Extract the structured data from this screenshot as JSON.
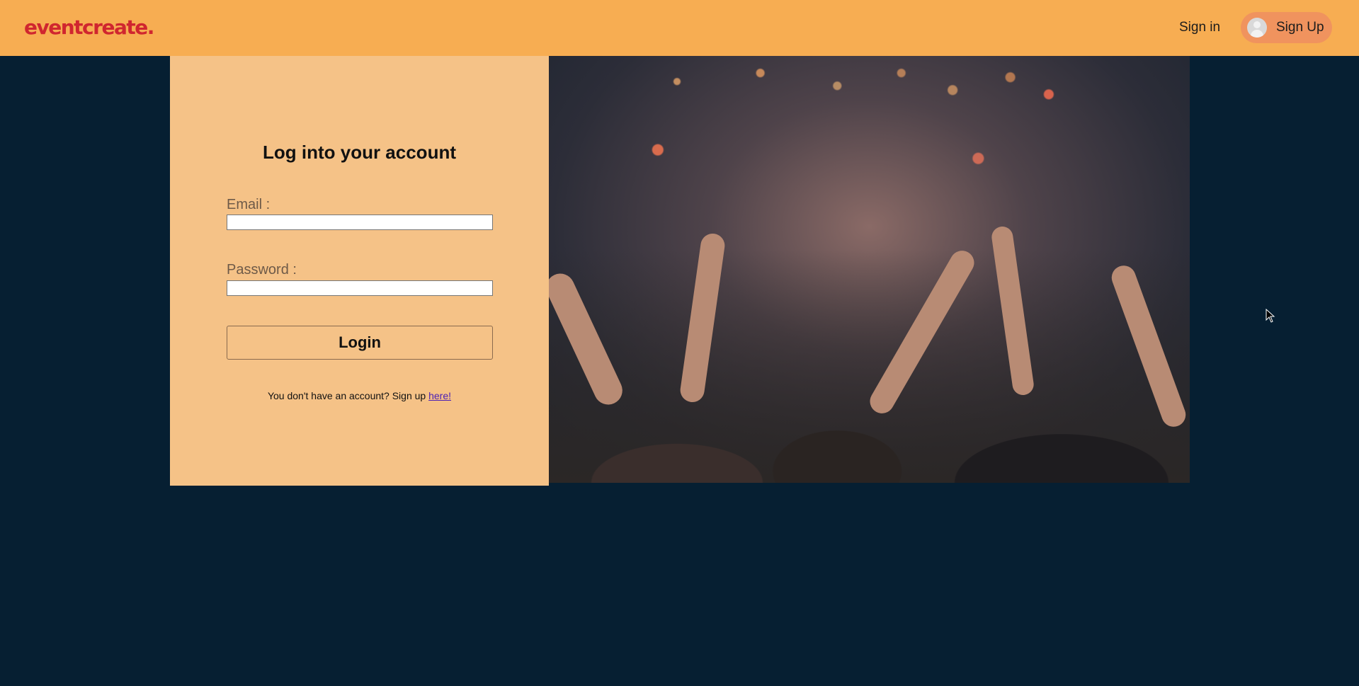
{
  "header": {
    "logo_text": "eventcreate.",
    "signin_label": "Sign in",
    "signup_label": "Sign Up"
  },
  "login": {
    "title": "Log into your account",
    "email_label": "Email :",
    "email_value": "",
    "password_label": "Password :",
    "password_value": "",
    "submit_label": "Login",
    "signup_prompt": "You don't have an account? Sign up",
    "signup_link": "here!"
  },
  "colors": {
    "navbar": "#f7ad52",
    "logo": "#d0262f",
    "signup_button": "#f0935e",
    "panel": "#f5c287",
    "page_background": "#061f32"
  },
  "icons": {
    "avatar": "user-avatar-icon",
    "cursor": "mouse-pointer-icon"
  }
}
